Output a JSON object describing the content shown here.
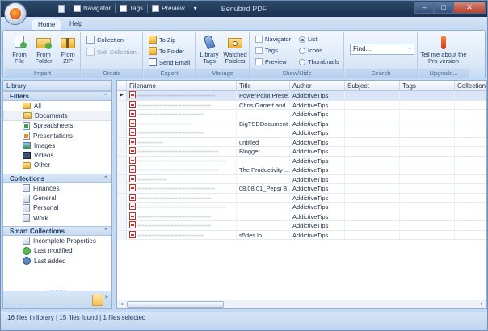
{
  "titlebar": {
    "app_title": "Benubird PDF",
    "quick_access": [
      {
        "label": "Navigator"
      },
      {
        "label": "Tags"
      },
      {
        "label": "Preview"
      }
    ],
    "chevron": "▾",
    "buttons": {
      "minimize": "–",
      "maximize": "□",
      "close": "✕"
    }
  },
  "tabs": [
    {
      "label": "Home",
      "active": true
    },
    {
      "label": "Help",
      "active": false
    }
  ],
  "ribbon": {
    "import": {
      "label": "Import",
      "from_file": "From File",
      "from_folder": "From Folder",
      "from_zip": "From ZIP"
    },
    "create": {
      "label": "Create",
      "collection": "Collection",
      "sub_collection": "Sub-Collection"
    },
    "export": {
      "label": "Export",
      "to_zip": "To Zip",
      "to_folder": "To Folder",
      "send_email": "Send Email"
    },
    "manage": {
      "label": "Manage",
      "library_tags": "Library Tags",
      "watched_folders": "Watched Folders"
    },
    "showhide": {
      "label": "Show/Hide",
      "navigator": "Navigator",
      "tags": "Tags",
      "preview": "Preview",
      "list": "List",
      "icons": "Icons",
      "thumbnails": "Thumbnails"
    },
    "search": {
      "label": "Search",
      "value": "Find...",
      "dropdown": "▾"
    },
    "upgrade": {
      "label": "Upgrade...",
      "tell_me": "Tell me about the Pro version"
    }
  },
  "sidebar": {
    "header": "Library",
    "filters_title": "Filters",
    "filters": [
      "All",
      "Documents",
      "Spreadsheets",
      "Presentations",
      "Images",
      "Videos",
      "Other"
    ],
    "collections_title": "Collections",
    "collections": [
      "Finances",
      "General",
      "Personal",
      "Work"
    ],
    "smart_title": "Smart Collections",
    "smart": [
      "Incomplete Properties",
      "Last modified",
      "Last added"
    ],
    "collapse_glyph": "⌃",
    "more_glyph": "»",
    "grip": "........"
  },
  "table": {
    "columns": [
      "Filename",
      "Title",
      "Author",
      "Subject",
      "Tags",
      "Collection"
    ],
    "rows": [
      {
        "filename": "~~~~~~~~~~~~~~~~~~~~~",
        "title": "PowerPoint Prese...",
        "author": "AddictiveTips"
      },
      {
        "filename": "~~~~~~~~~~~~~~~~~~~~",
        "title": "Chris Garrett  and ...",
        "author": "AddictiveTips"
      },
      {
        "filename": "~~~~~~~~~~~~~~~~~~",
        "title": "",
        "author": "AddictiveTips"
      },
      {
        "filename": "~~~~~~~~~~~~~~~",
        "title": "BigTSDDocument",
        "author": "AddictiveTips"
      },
      {
        "filename": "~~~~~~~~~~~~~~~~~~",
        "title": "",
        "author": "AddictiveTips"
      },
      {
        "filename": "~~~~~~~",
        "title": "untitled",
        "author": "AddictiveTips"
      },
      {
        "filename": "~~~~~~~~~~~~~~~~~~~~~~",
        "title": "Blogger",
        "author": "AddictiveTips"
      },
      {
        "filename": "~~~~~~~~~~~~~~~~~~~~~~~~",
        "title": "",
        "author": "AddictiveTips"
      },
      {
        "filename": "~~~~~~~~~~~~~~~~~~~~~~",
        "title": "The Productivity ...",
        "author": "AddictiveTips"
      },
      {
        "filename": "~~~~~~~~",
        "title": "",
        "author": "AddictiveTips"
      },
      {
        "filename": "~~~~~~~~~~~~~~~~~~~~~",
        "title": "08.08.01_Pepsi B...",
        "author": "AddictiveTips"
      },
      {
        "filename": "~~~~~~~~~~~~~~~~~~~~",
        "title": "",
        "author": "AddictiveTips"
      },
      {
        "filename": "~~~~~~~~~~~~~~~~~~~~~~~~",
        "title": "",
        "author": "AddictiveTips"
      },
      {
        "filename": "~~~~~~~~~~~~~~~~~~~~",
        "title": "",
        "author": "AddictiveTips"
      },
      {
        "filename": "~~~~~~~~~~~~~~~~~~~~",
        "title": "",
        "author": "AddictiveTips"
      },
      {
        "filename": "~~~~~~~~~~~~~~~~~~",
        "title": "s5des.lo",
        "author": "AddictiveTips"
      }
    ],
    "row_indicator": "▶",
    "scroll_left": "◂",
    "scroll_right": "▸"
  },
  "status": {
    "text": "16 files in library | 15 files found | 1 files selected"
  },
  "colors": {
    "accent": "#1b3150",
    "ribbon": "#dbe8f7",
    "selection": "#d9e6f8"
  }
}
